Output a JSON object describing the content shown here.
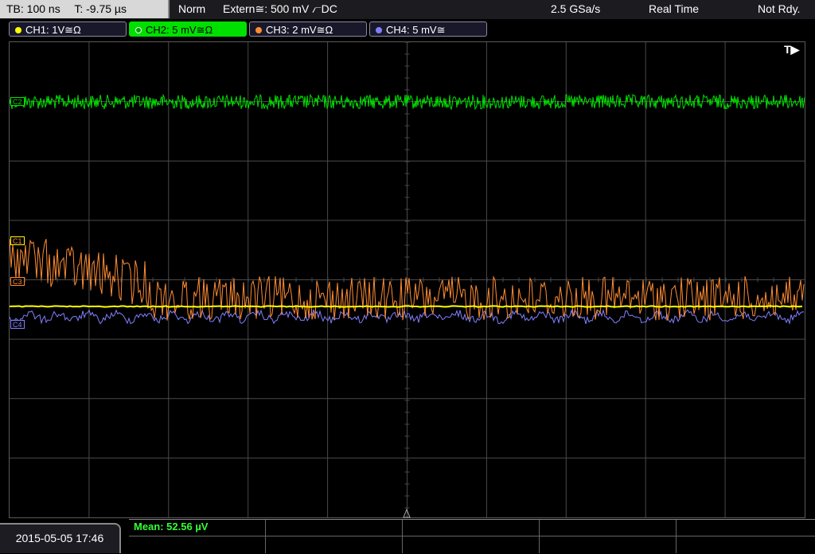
{
  "status_bar": {
    "timebase": "TB: 100 ns",
    "trigger_offset": "T: -9.75 µs",
    "trigger_mode": "Norm",
    "trigger_source": "Extern≅: 500 mV ⦧DC",
    "sample_rate": "2.5 GSa/s",
    "acq_mode": "Real Time",
    "state": "Not Rdy."
  },
  "channels": [
    {
      "label": "CH1: 1V≅Ω",
      "color": "#ffff00",
      "active": false
    },
    {
      "label": "CH2: 5 mV≅Ω",
      "color": "#00e000",
      "active": true
    },
    {
      "label": "CH3: 2 mV≅Ω",
      "color": "#ff8c33",
      "active": false
    },
    {
      "label": "CH4: 5 mV≅",
      "color": "#8080ff",
      "active": false
    }
  ],
  "markers": {
    "ch2": "C2",
    "ch1": "C1",
    "ch3": "C3",
    "ch4": "C4"
  },
  "trigger_indicator": "T▶",
  "footer": {
    "datetime": "2015-05-05 17:46",
    "measurement": "Mean: 52.56 µV"
  },
  "colors": {
    "ch1": "#ffff00",
    "ch2": "#00e000",
    "ch3": "#ff8c33",
    "ch4": "#8080ff",
    "grid": "#4a4a4a"
  }
}
